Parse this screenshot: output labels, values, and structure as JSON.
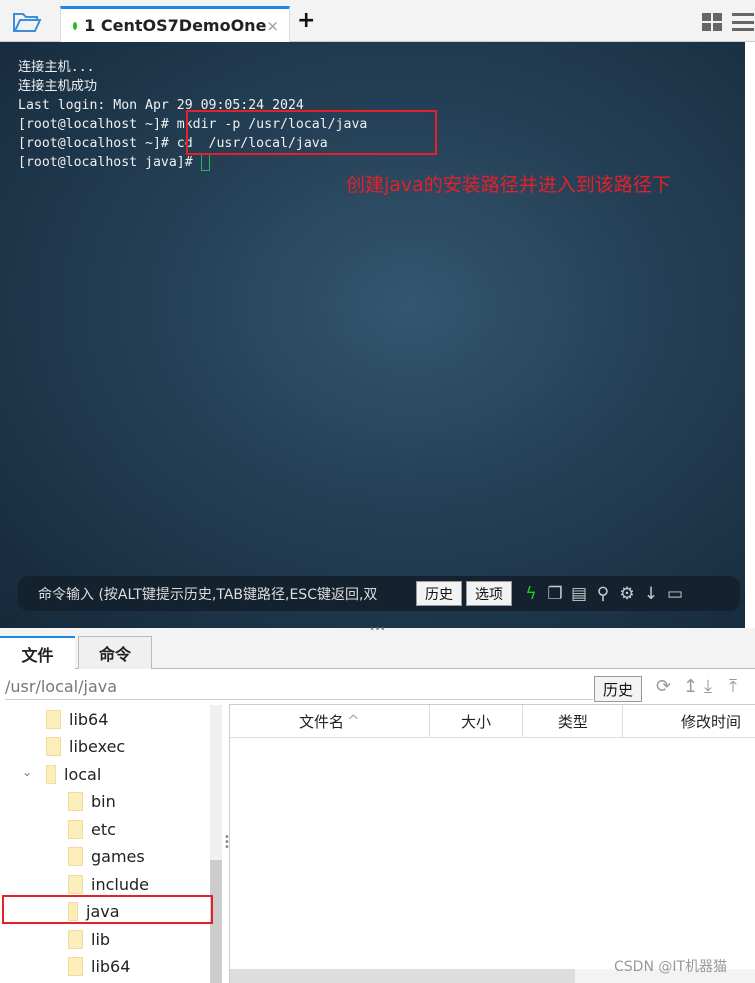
{
  "tabbar": {
    "tab_number": "1",
    "tab_title": "CentOS7DemoOne",
    "close": "×",
    "new_tab": "+"
  },
  "terminal": {
    "lines": [
      "连接主机...",
      "连接主机成功",
      "Last login: Mon Apr 29 09:05:24 2024",
      "[root@localhost ~]# mkdir -p /usr/local/java",
      "[root@localhost ~]# cd  /usr/local/java",
      "[root@localhost java]# "
    ],
    "annotation": "创建java的安装路径并进入到该路径下",
    "annotation_color": "#e5202a"
  },
  "cmdbar": {
    "placeholder": "命令输入 (按ALT键提示历史,TAB键路径,ESC键返回,双",
    "history": "历史",
    "options": "选项"
  },
  "bottom_tabs": [
    "文件",
    "命令"
  ],
  "files": {
    "path": "/usr/local/java",
    "history": "历史",
    "tree": [
      {
        "name": "lib64",
        "level": 1
      },
      {
        "name": "libexec",
        "level": 1
      },
      {
        "name": "local",
        "level": 1,
        "expanded": true
      },
      {
        "name": "bin",
        "level": 2
      },
      {
        "name": "etc",
        "level": 2
      },
      {
        "name": "games",
        "level": 2
      },
      {
        "name": "include",
        "level": 2
      },
      {
        "name": "java",
        "level": 2,
        "selected": true
      },
      {
        "name": "lib",
        "level": 2
      },
      {
        "name": "lib64",
        "level": 2
      }
    ],
    "columns": [
      "文件名",
      "大小",
      "类型",
      "修改时间"
    ]
  },
  "watermark": "CSDN @IT机器猫"
}
